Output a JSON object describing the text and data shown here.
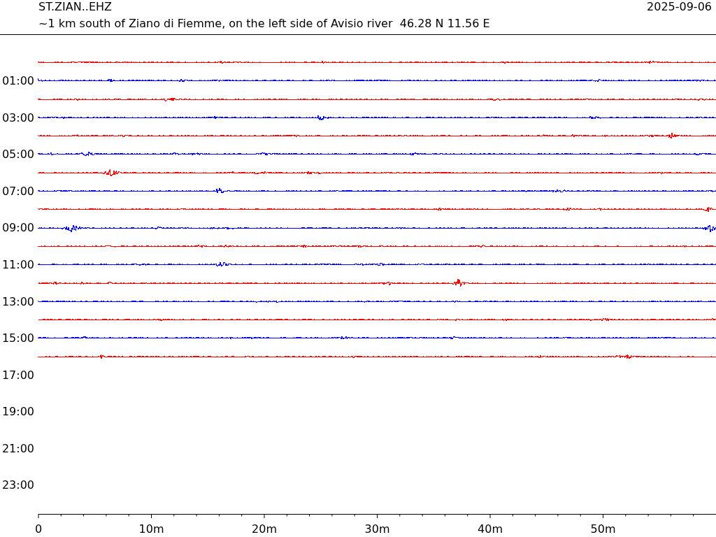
{
  "header": {
    "station": "ST.ZIAN..EHZ",
    "date": "2025-09-06",
    "location": "~1 km south of Ziano di Fiemme, on the left side of Avisio river  46.28 N 11.56 E"
  },
  "rows": [
    {
      "color": "#ff0000"
    },
    {
      "label": "01:00",
      "color": "#0000ff"
    },
    {
      "color": "#ff0000"
    },
    {
      "label": "03:00",
      "color": "#0000ff"
    },
    {
      "color": "#ff0000"
    },
    {
      "label": "05:00",
      "color": "#0000ff"
    },
    {
      "color": "#ff0000"
    },
    {
      "label": "07:00",
      "color": "#0000ff"
    },
    {
      "color": "#ff0000"
    },
    {
      "label": "09:00",
      "color": "#0000ff"
    },
    {
      "color": "#ff0000"
    },
    {
      "label": "11:00",
      "color": "#0000ff"
    },
    {
      "color": "#ff0000"
    },
    {
      "label": "13:00",
      "color": "#0000ff"
    },
    {
      "color": "#ff0000"
    },
    {
      "label": "15:00",
      "color": "#0000ff"
    },
    {
      "color": "#ff0000"
    },
    {
      "label": "17:00"
    },
    {},
    {
      "label": "19:00"
    },
    {},
    {
      "label": "21:00"
    },
    {},
    {
      "label": "23:00"
    }
  ],
  "x_axis": {
    "labels": [
      "0",
      "10m",
      "20m",
      "30m",
      "40m",
      "50m"
    ]
  }
}
